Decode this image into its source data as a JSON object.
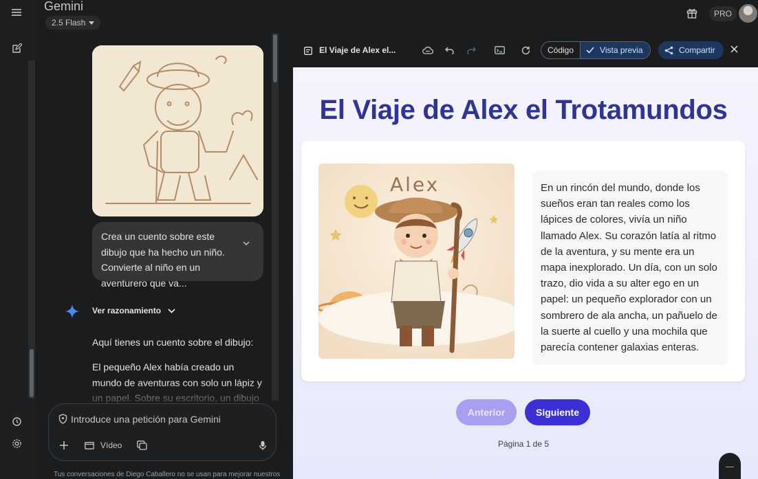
{
  "app": {
    "title": "Gemini",
    "model": "2.5 Flash",
    "plan_badge": "PRO"
  },
  "rail": {
    "icons": [
      "menu-icon",
      "new-chat-icon",
      "history-icon",
      "settings-icon"
    ]
  },
  "chat": {
    "user_message": "Crea un cuento sobre este dibujo que ha hecho un niño. Convierte al niño en un aventurero que va...",
    "reasoning_label": "Ver razonamiento",
    "response_intro": "Aquí tienes un cuento sobre el dibujo:",
    "response_text": "El pequeño Alex había creado un mundo de aventuras con solo un lápiz y un papel. Sobre su escritorio, un dibujo cobraba"
  },
  "composer": {
    "placeholder": "Introduce una petición para Gemini",
    "video_label": "Vídeo"
  },
  "footnote": "Tus conversaciones de Diego Caballero no se usan para mejorar nuestros",
  "preview": {
    "doc_title": "El Viaje de Alex el...",
    "code_tab": "Código",
    "preview_tab": "Vista previa",
    "share_label": "Compartir",
    "story_title": "El Viaje de Alex el Trotamundos",
    "illustration_name": "Alex",
    "story_text": "En un rincón del mundo, donde los sueños eran tan reales como los lápices de colores, vivía un niño llamado Alex. Su corazón latía al ritmo de la aventura, y su mente era un mapa inexplorado. Un día, con un solo trazo, dio vida a su alter ego en un papel: un pequeño explorador con un sombrero de ala ancha, un pañuelo de la suerte al cuello y una mochila que parecía contener galaxias enteras.",
    "prev_label": "Anterior",
    "next_label": "Siguiente",
    "page_info": "Página 1 de 5"
  },
  "colors": {
    "title_blue": "#2e3592",
    "next_button": "#3b2fd6",
    "prev_button": "#a99ef0",
    "accent_chip": "#1f3760"
  }
}
